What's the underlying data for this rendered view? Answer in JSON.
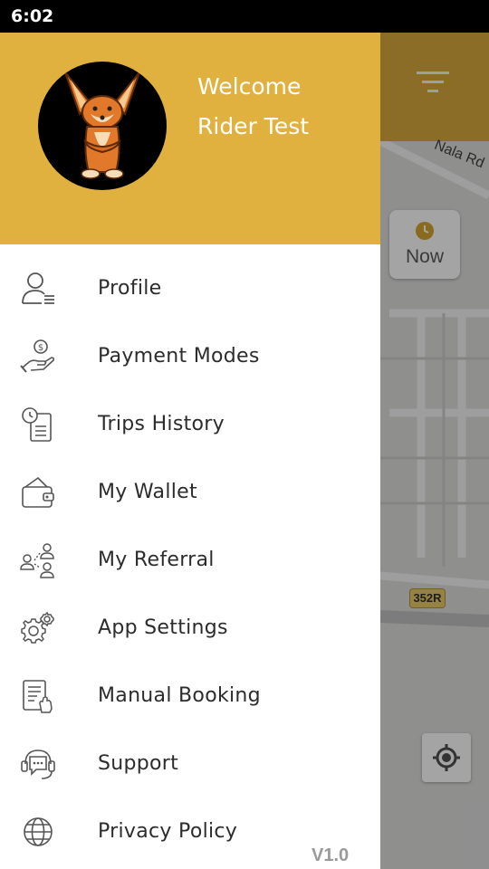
{
  "status_bar": {
    "time": "6:02"
  },
  "background": {
    "road_label": "Nala Rd",
    "now_button_label": "Now",
    "route_badge": "352R",
    "header_color": "#e1b13f"
  },
  "drawer": {
    "welcome_text": "Welcome",
    "user_name": "Rider Test",
    "menu": [
      {
        "label": "Profile",
        "icon": "profile-icon"
      },
      {
        "label": "Payment Modes",
        "icon": "payment-icon"
      },
      {
        "label": "Trips History",
        "icon": "trips-history-icon"
      },
      {
        "label": "My Wallet",
        "icon": "wallet-icon"
      },
      {
        "label": "My Referral",
        "icon": "referral-icon"
      },
      {
        "label": "App Settings",
        "icon": "settings-icon"
      },
      {
        "label": "Manual Booking",
        "icon": "manual-booking-icon"
      },
      {
        "label": "Support",
        "icon": "support-icon"
      },
      {
        "label": "Privacy Policy",
        "icon": "globe-icon"
      }
    ],
    "version": "V1.0"
  }
}
